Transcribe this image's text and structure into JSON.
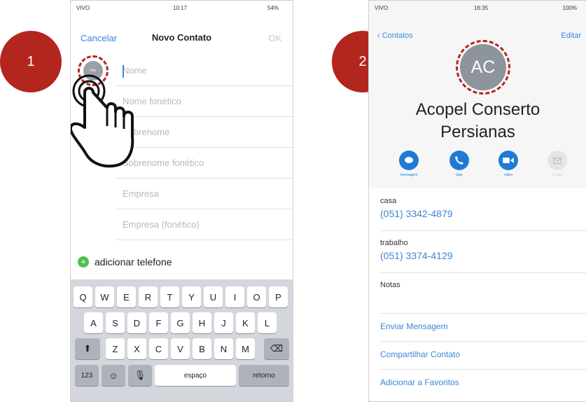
{
  "steps": {
    "one": "1",
    "two": "2"
  },
  "left_phone": {
    "status": {
      "carrier": "VIVO",
      "time": "10:17",
      "battery": "54%"
    },
    "nav": {
      "cancel": "Cancelar",
      "title": "Novo Contato",
      "ok": "OK"
    },
    "photo_label": "foto",
    "fields": [
      "Nome",
      "Nome fonético",
      "Sobrenome",
      "Sobrenome fonético",
      "Empresa",
      "Empresa (fonético)"
    ],
    "add_phone": "adicionar telefone",
    "keyboard": {
      "row1": [
        "Q",
        "W",
        "E",
        "R",
        "T",
        "Y",
        "U",
        "I",
        "O",
        "P"
      ],
      "row2": [
        "A",
        "S",
        "D",
        "F",
        "G",
        "H",
        "J",
        "K",
        "L"
      ],
      "row3": [
        "Z",
        "X",
        "C",
        "V",
        "B",
        "N",
        "M"
      ],
      "numbers": "123",
      "space": "espaço",
      "return": "retorno"
    }
  },
  "right_phone": {
    "status": {
      "carrier": "VIVO",
      "time": "16:35",
      "battery": "100%"
    },
    "nav": {
      "back": "Contatos",
      "edit": "Editar"
    },
    "initials": "AC",
    "name_line1": "Acopel Conserto",
    "name_line2": "Persianas",
    "actions": [
      "mensagem",
      "ligar",
      "vídeo",
      "e-mail"
    ],
    "phones": [
      {
        "label": "casa",
        "number": "(051) 3342-4879"
      },
      {
        "label": "trabalho",
        "number": "(051) 3374-4129"
      }
    ],
    "notes_label": "Notas",
    "links": [
      "Enviar Mensagem",
      "Compartilhar Contato",
      "Adicionar a Favoritos"
    ]
  },
  "colors": {
    "accent": "#3b86d6",
    "badge": "#b3261e",
    "green": "#4cc24e"
  }
}
